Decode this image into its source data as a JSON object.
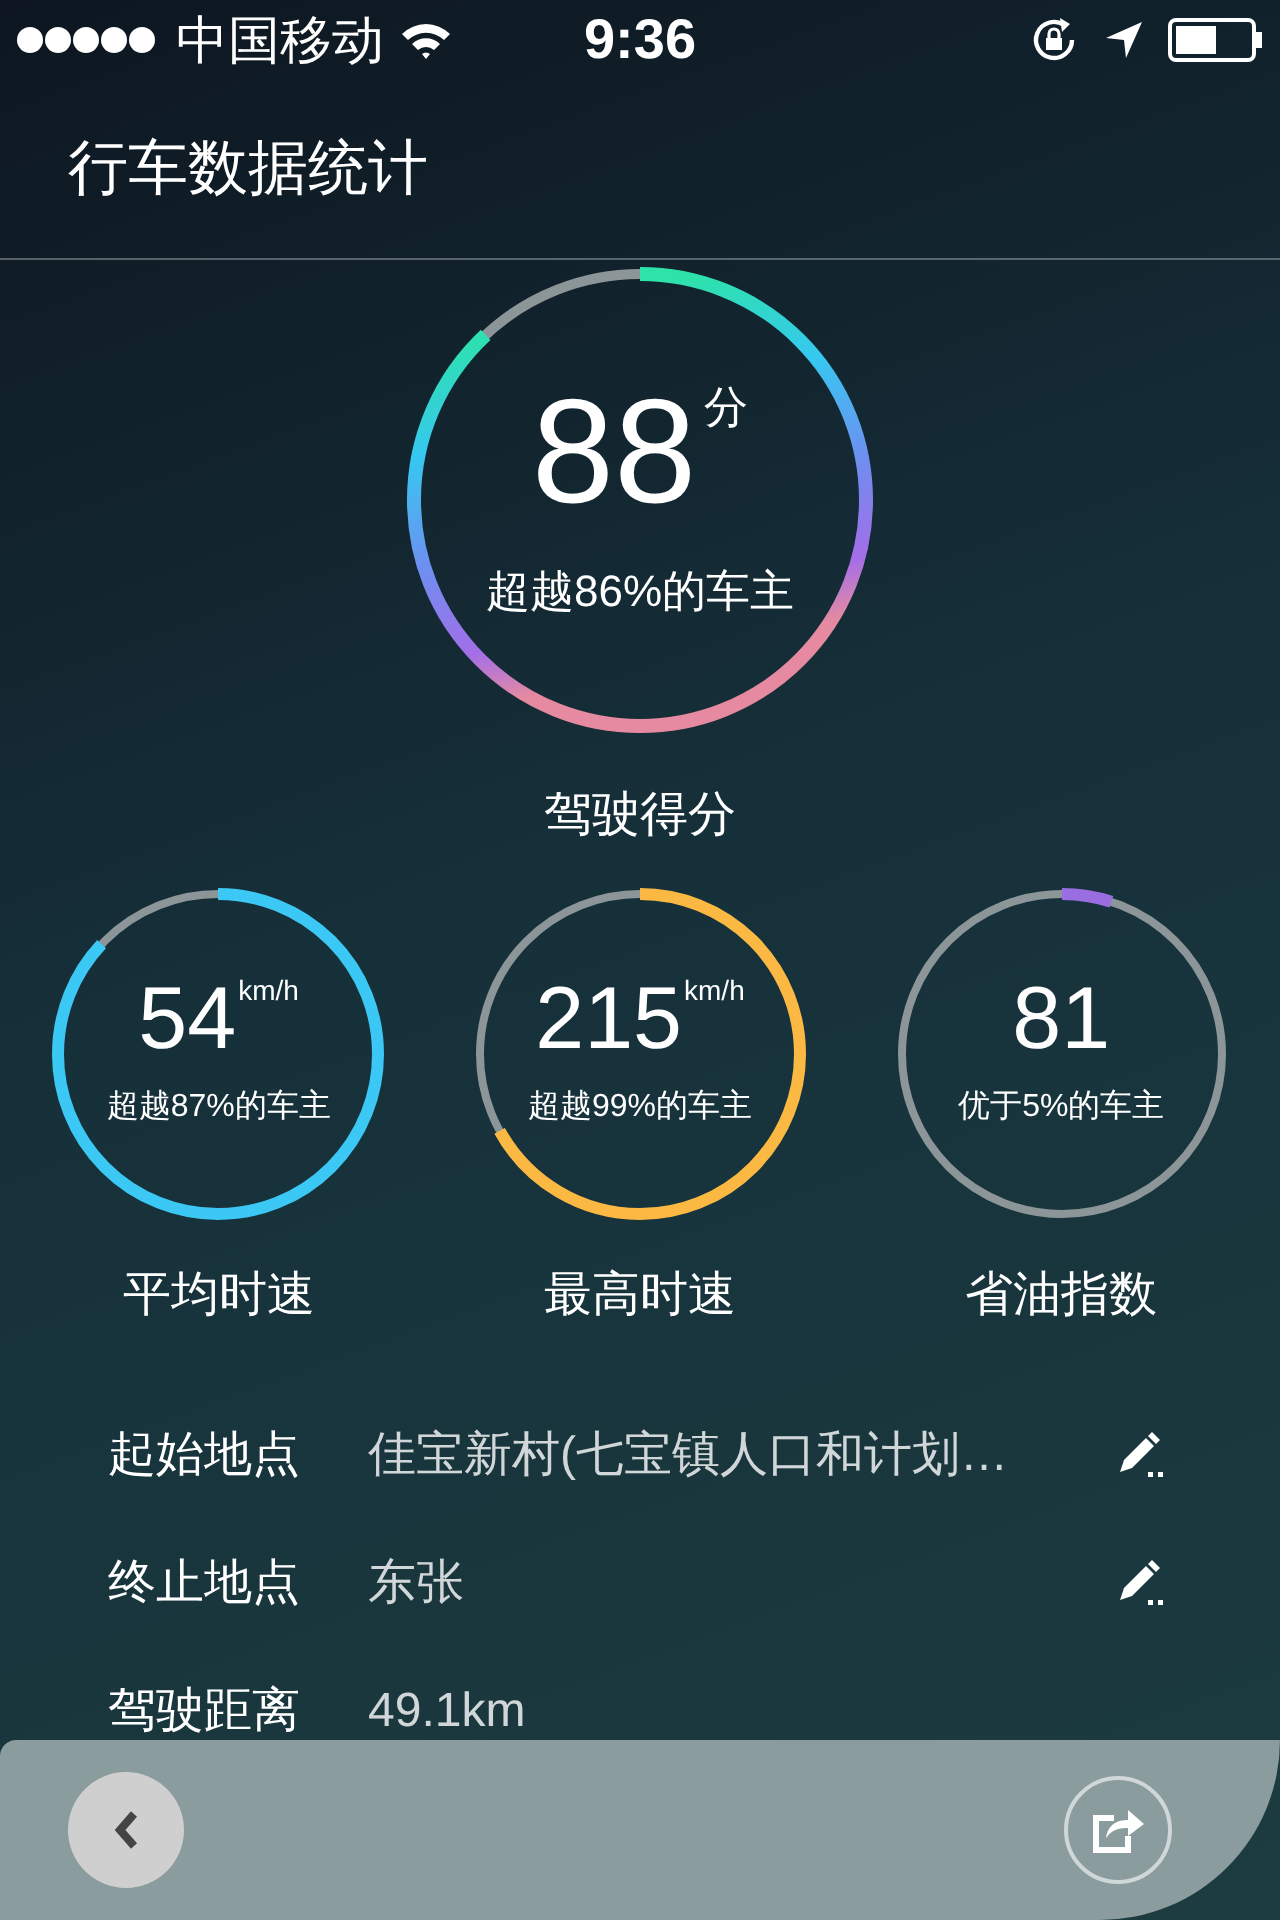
{
  "status_bar": {
    "carrier": "中国移动",
    "time": "9:36"
  },
  "header": {
    "title": "行车数据统计"
  },
  "score": {
    "value": "88",
    "unit": "分",
    "caption": "超越86%的车主",
    "label": "驾驶得分",
    "level": 0.88
  },
  "gauges": [
    {
      "value": "54",
      "unit": "km/h",
      "caption": "超越87%的车主",
      "label": "平均时速",
      "level": 0.87,
      "color": "#3cc8f4"
    },
    {
      "value": "215",
      "unit": "km/h",
      "caption": "超越99%的车主",
      "label": "最高时速",
      "level": 0.67,
      "color": "#fbb944"
    },
    {
      "value": "81",
      "caption": "优于5%的车主",
      "label": "省油指数",
      "level": 0.05,
      "color": "#9a6ee0"
    }
  ],
  "details": [
    {
      "label": "起始地点",
      "value": "佳宝新村(七宝镇人口和计划…",
      "editable": true
    },
    {
      "label": "终止地点",
      "value": "东张",
      "editable": true
    },
    {
      "label": "驾驶距离",
      "value": "49.1km",
      "editable": false
    }
  ]
}
